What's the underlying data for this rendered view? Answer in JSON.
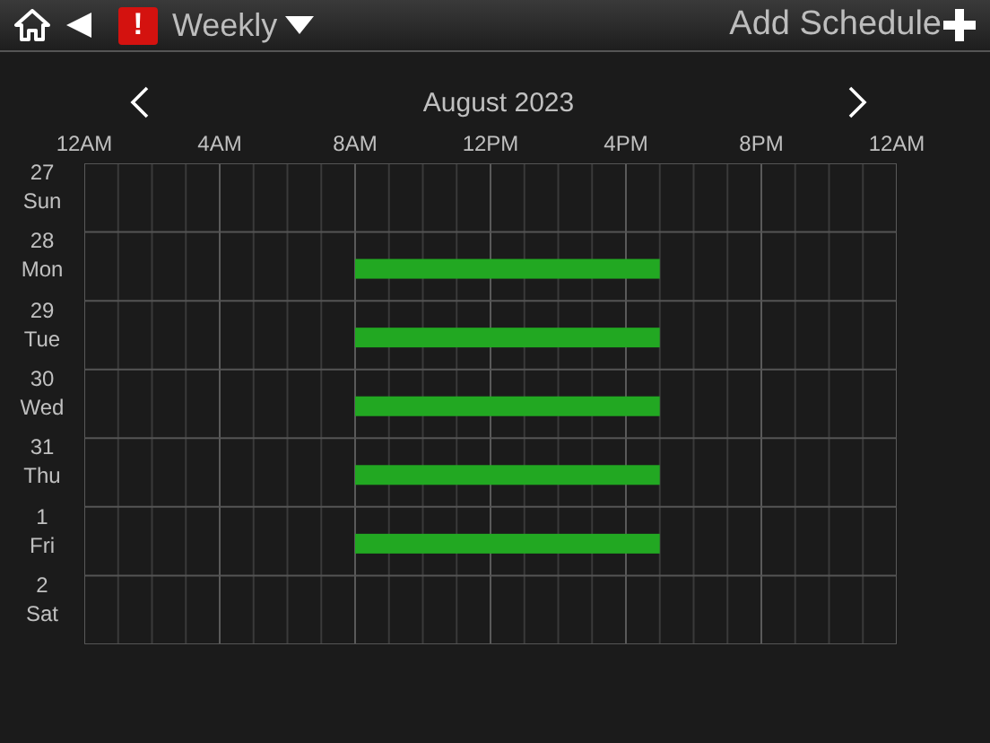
{
  "toolbar": {
    "alert": "!",
    "view": "Weekly",
    "add_button": "Add Schedule"
  },
  "calendar": {
    "month": "August 2023",
    "hours": [
      "12AM",
      "4AM",
      "8AM",
      "12PM",
      "4PM",
      "8PM",
      "12AM"
    ],
    "days": [
      {
        "date": "27",
        "weekday": "Sun",
        "scheduled": false
      },
      {
        "date": "28",
        "weekday": "Mon",
        "scheduled": true
      },
      {
        "date": "29",
        "weekday": "Tue",
        "scheduled": true
      },
      {
        "date": "30",
        "weekday": "Wed",
        "scheduled": true
      },
      {
        "date": "31",
        "weekday": "Thu",
        "scheduled": true
      },
      {
        "date": "1",
        "weekday": "Fri",
        "scheduled": true
      },
      {
        "date": "2",
        "weekday": "Sat",
        "scheduled": false
      }
    ]
  }
}
